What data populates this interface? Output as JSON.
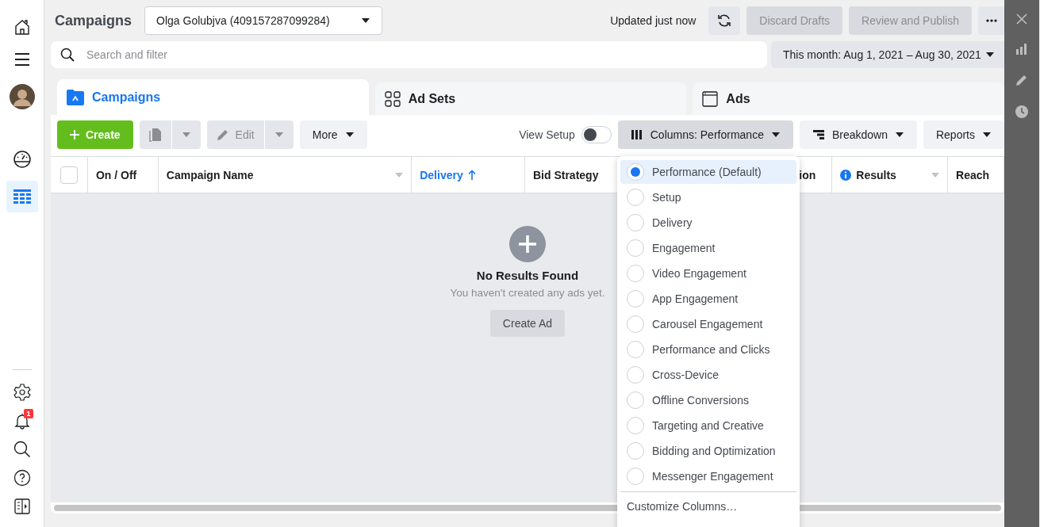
{
  "sidebar": {
    "items": [
      {
        "kind": "home",
        "selected": false
      },
      {
        "kind": "menu",
        "selected": false
      },
      {
        "kind": "avatar",
        "selected": false
      },
      {
        "kind": "gauge",
        "selected": false
      },
      {
        "kind": "table",
        "selected": true
      }
    ],
    "bottom_items": [
      {
        "kind": "settings"
      },
      {
        "kind": "bell",
        "badge": "1"
      },
      {
        "kind": "search"
      },
      {
        "kind": "help"
      },
      {
        "kind": "panel"
      }
    ]
  },
  "header": {
    "title": "Campaigns",
    "account": "Olga Golubjva (409157287099284)",
    "status": "Updated just now",
    "buttons": [
      {
        "label": "Discard Drafts",
        "disabled": true
      },
      {
        "label": "Review and Publish",
        "disabled": true
      }
    ]
  },
  "search": {
    "placeholder": "Search and filter"
  },
  "date_range": "This month: Aug 1, 2021 – Aug 30, 2021",
  "tabs": [
    {
      "kind": "campaigns",
      "label": "Campaigns",
      "selected": true
    },
    {
      "kind": "adsets",
      "label": "Ad Sets",
      "selected": false
    },
    {
      "kind": "ads",
      "label": "Ads",
      "selected": false
    }
  ],
  "toolbar": {
    "create": "Create",
    "edit": "Edit",
    "more": "More",
    "view_setup": {
      "label": "View Setup",
      "on": false
    },
    "columns": "Columns: Performance",
    "breakdown": "Breakdown",
    "reports": "Reports"
  },
  "table": {
    "select_all_checked": false,
    "columns": [
      {
        "label": "On / Off",
        "sorted": false,
        "menu": false,
        "info": false
      },
      {
        "label": "Campaign Name",
        "sorted": false,
        "menu": true,
        "info": false
      },
      {
        "label": "Delivery",
        "sorted": true,
        "menu": false,
        "info": false
      },
      {
        "label": "Bid Strategy",
        "sorted": false,
        "menu": false,
        "info": false
      },
      {
        "label": "ion"
      },
      {
        "label": "Results",
        "sorted": false,
        "menu": true,
        "info": true
      },
      {
        "label": "Reach",
        "sorted": false,
        "menu": false,
        "info": false
      }
    ],
    "empty": {
      "title": "No Results Found",
      "message": "You haven't created any ads yet.",
      "button": "Create Ad"
    }
  },
  "columns_menu": {
    "options": [
      {
        "label": "Performance (Default)",
        "selected": true
      },
      {
        "label": "Setup",
        "selected": false
      },
      {
        "label": "Delivery",
        "selected": false
      },
      {
        "label": "Engagement",
        "selected": false
      },
      {
        "label": "Video Engagement",
        "selected": false
      },
      {
        "label": "App Engagement",
        "selected": false
      },
      {
        "label": "Carousel Engagement",
        "selected": false
      },
      {
        "label": "Performance and Clicks",
        "selected": false
      },
      {
        "label": "Cross-Device",
        "selected": false
      },
      {
        "label": "Offline Conversions",
        "selected": false
      },
      {
        "label": "Targeting and Creative",
        "selected": false
      },
      {
        "label": "Bidding and Optimization",
        "selected": false
      },
      {
        "label": "Messenger Engagement",
        "selected": false
      }
    ],
    "customize": "Customize Columns…"
  }
}
